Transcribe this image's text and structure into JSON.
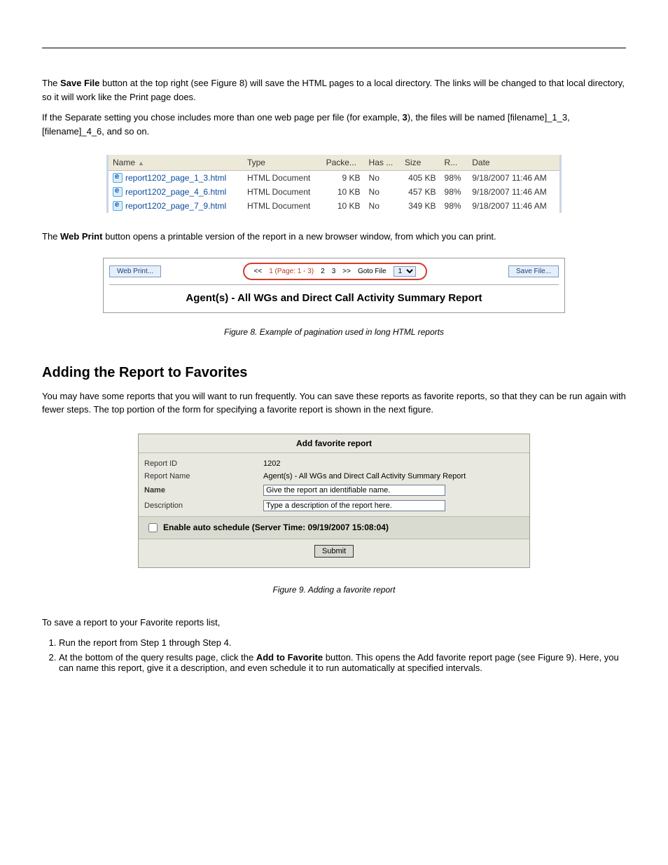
{
  "intro_p1_a": "The ",
  "intro_p1_b": "Save File",
  "intro_p1_c": " button at the top right (see Figure 8) will save the HTML pages to a local directory. The links will be changed to that local directory, so it will work like the Print page does.",
  "intro_p2_a": "If the Separate setting you chose includes more than one web page per file (for example, ",
  "intro_p2_b": "3",
  "intro_p2_c": "), the files will be named [filename]_1_3, [filename]_4_6, and so on.",
  "file_table": {
    "headers": [
      "Name",
      "Type",
      "Packe...",
      "Has ...",
      "Size",
      "R...",
      "Date"
    ],
    "rows": [
      {
        "name": "report1202_page_1_3.html",
        "type": "HTML Document",
        "packed": "9 KB",
        "has": "No",
        "size": "405 KB",
        "r": "98%",
        "date": "9/18/2007 11:46 AM"
      },
      {
        "name": "report1202_page_4_6.html",
        "type": "HTML Document",
        "packed": "10 KB",
        "has": "No",
        "size": "457 KB",
        "r": "98%",
        "date": "9/18/2007 11:46 AM"
      },
      {
        "name": "report1202_page_7_9.html",
        "type": "HTML Document",
        "packed": "10 KB",
        "has": "No",
        "size": "349 KB",
        "r": "98%",
        "date": "9/18/2007 11:46 AM"
      }
    ]
  },
  "mid_p_a": "The ",
  "mid_p_b": "Web Print",
  "mid_p_c": " button opens a printable version of the report in a new browser window, from which you can print.",
  "report_bar": {
    "web_print": "Web Print...",
    "pager_prev": "<<",
    "pager_cur": "1 (Page: 1 - 3)",
    "pager_2": "2",
    "pager_3": "3",
    "pager_next": ">>",
    "goto_label": "Goto File",
    "goto_sel": "1",
    "save_file": "Save File..."
  },
  "report_title": "Agent(s) - All WGs and Direct Call Activity Summary Report",
  "fig8_caption": "Figure 8. Example of pagination used in long HTML reports",
  "section_title": "Adding the Report to Favorites",
  "fav_p1": "You may have some reports that you will want to run frequently. You can save these reports as favorite reports, so that they can be run again with fewer steps. The top portion of the form for specifying a favorite report is shown in the next figure.",
  "fav_form": {
    "title": "Add favorite report",
    "id_label": "Report ID",
    "id_val": "1202",
    "name_label": "Report Name",
    "name_val": "Agent(s) - All WGs and Direct Call Activity Summary Report",
    "user_name_label": "Name",
    "user_name_val": "Give the report an identifiable name.",
    "desc_label": "Description",
    "desc_val": "Type a description of the report here.",
    "sched_label": "Enable auto schedule (Server Time: 09/19/2007 15:08:04)",
    "submit": "Submit"
  },
  "fig9_caption": "Figure 9. Adding a favorite report",
  "steps_intro": "To save a report to your Favorite reports list,",
  "steps": [
    "Run the report from Step 1 through Step 4.",
    "At the bottom of the query results page, click the Add to Favorite button. This opens the Add favorite report page (see Figure 9). Here, you can name this report, give it a description, and even schedule it to run automatically at specified intervals."
  ],
  "add_fav_label": "Add to Favorite"
}
